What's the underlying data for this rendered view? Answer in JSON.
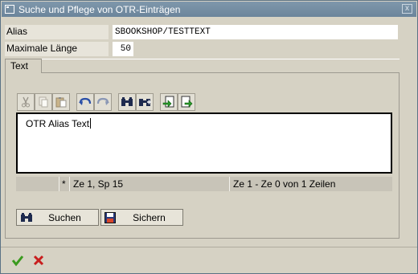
{
  "window": {
    "title": "Suche und Pflege von OTR-Einträgen",
    "close_symbol": "x"
  },
  "fields": {
    "alias": {
      "label": "Alias",
      "value": "SBOOKSHOP/TESTTEXT"
    },
    "max_length": {
      "label": "Maximale Länge",
      "value": "50"
    }
  },
  "group": {
    "tab_label": "Text"
  },
  "toolbar": {
    "icons": [
      "cut-icon",
      "copy-icon",
      "paste-icon",
      "undo-icon",
      "redo-icon",
      "find-icon",
      "find-next-icon",
      "import-icon",
      "export-icon"
    ]
  },
  "editor": {
    "text": "OTR Alias Text"
  },
  "status": {
    "mode": "",
    "modified": "*",
    "position": "Ze 1, Sp 15",
    "lines": "Ze 1 - Ze 0 von 1 Zeilen"
  },
  "buttons": {
    "search": "Suchen",
    "save": "Sichern"
  },
  "footer": {
    "confirm_icon": "check-icon",
    "cancel_icon": "cancel-icon"
  },
  "colors": {
    "background": "#d6d2c4",
    "titlebar": "#6b859b",
    "confirm": "#3a9a1e",
    "cancel": "#c81e1e"
  }
}
